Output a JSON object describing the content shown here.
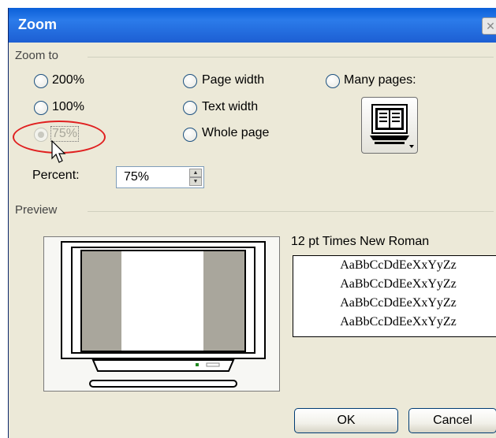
{
  "dialog": {
    "title": "Zoom",
    "close_label": "✕"
  },
  "zoom_to": {
    "group_label": "Zoom to",
    "options": [
      {
        "label": "200%",
        "selected": false,
        "enabled": true
      },
      {
        "label": "100%",
        "selected": false,
        "enabled": true
      },
      {
        "label": "75%",
        "selected": true,
        "enabled": false
      },
      {
        "label": "Page width",
        "selected": false,
        "enabled": true
      },
      {
        "label": "Text width",
        "selected": false,
        "enabled": true
      },
      {
        "label": "Whole page",
        "selected": false,
        "enabled": true
      },
      {
        "label": "Many pages:",
        "selected": false,
        "enabled": true
      }
    ],
    "many_pages_icon": "monitor-book-icon",
    "percent_label": "Percent:",
    "percent_value": "75%"
  },
  "preview": {
    "group_label": "Preview",
    "font_name": "12 pt Times New Roman",
    "sample_lines": [
      "AaBbCcDdEeXxYyZz",
      "AaBbCcDdEeXxYyZz",
      "AaBbCcDdEeXxYyZz",
      "AaBbCcDdEeXxYyZz"
    ]
  },
  "buttons": {
    "ok": "OK",
    "cancel": "Cancel"
  },
  "colors": {
    "dialog_bg": "#ece9d8",
    "titlebar": "#1d5fd3",
    "highlight_ring": "#e02020"
  }
}
